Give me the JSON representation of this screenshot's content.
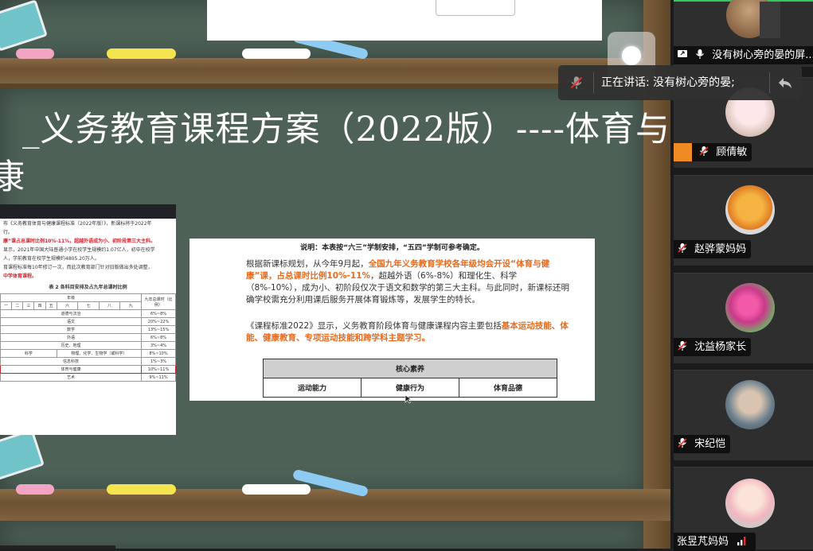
{
  "slide": {
    "title_line1": "_义务教育课程方案（2022版）----体育与",
    "title_line2": "康",
    "doc_image": {
      "line1": "布《义务教育体育与健康课程标准（2022年版）》，新课标将于2022年",
      "line2": "行。",
      "line3_red": "康”课占总课时比例10%-11%，超越外语成为小、初阶段第三大主科。",
      "line4": "显示，2021年中国大陆普通小学在校学生规模约1.07亿人，初中在校学",
      "line5": "人，学前教育在校学生规模约4805.20万人。",
      "line6": "育课程标准每10年修订一次，而此次教育部门针对旧版做出多处调整，",
      "line7_red": "中学体育课程。",
      "table_title": "表 2   各科目安排及占九年总课时比例",
      "col_header": "年级",
      "col_ratio": "九年总课时（比例）",
      "grades": [
        "一",
        "二",
        "三",
        "四",
        "五",
        "六",
        "七",
        "八",
        "九"
      ],
      "rows": [
        {
          "subject": "道德与法治",
          "ratio": "6%~8%"
        },
        {
          "subject": "语文",
          "ratio": "20%~22%"
        },
        {
          "subject": "数学",
          "ratio": "13%~15%"
        },
        {
          "subject": "外语",
          "ratio": "6%~8%"
        },
        {
          "subject": "历史、地理",
          "ratio": "3%~4%"
        },
        {
          "subject": "科学",
          "sub2": "物理、化学、生物学（或科学）",
          "ratio": "8%~10%"
        },
        {
          "subject": "信息科技",
          "ratio": "1%~3%"
        },
        {
          "subject": "体育与健康",
          "ratio": "10%~11%"
        },
        {
          "subject": "艺术",
          "ratio": "9%~11%"
        }
      ]
    },
    "info_panel": {
      "note": "说明：本表按“六三”学制安排，“五四”学制可参考确定。",
      "p1_a": "根据新课标规划，从今年9月起，",
      "p1_hl1": "全国九年义务教育学校各年级均会开设“体育与健康”课，占总课时比例10%-11%",
      "p1_b": "，超越外语（6%-8%）和理化生、科学（8%-10%），成为小、初阶段仅次于语文和数学的第三大主科。与此同时，新课标还明确学校需充分利用课后服务开展体育锻炼等，发展学生的特长。",
      "p2_a": "《课程标准2022》显示，义务教育阶段体育与健康课程内容主要包括",
      "p2_hl": "基本运动技能、体能、健康教育、专项运动技能和跨学科主题学习。",
      "table_head": "核心素养",
      "table_cells": [
        "运动能力",
        "健康行为",
        "体育品德"
      ]
    }
  },
  "speaking_tooltip": {
    "text": "正在讲话: 没有树心旁的晏;"
  },
  "participants": [
    {
      "name": "没有树心旁的晏的屏...",
      "mic": "on",
      "screen_share": true
    },
    {
      "name": "顾倩敏",
      "mic": "muted",
      "host_badge": true
    },
    {
      "name": "赵骅蒙妈妈",
      "mic": "muted"
    },
    {
      "name": "沈益杨家长",
      "mic": "muted"
    },
    {
      "name": "宋纪恺",
      "mic": "muted"
    },
    {
      "name": "张昱芃妈妈",
      "mic": "signal"
    }
  ],
  "colors": {
    "board": "#4d6157",
    "highlight_orange": "#e96a1c",
    "speaker_border": "#34c759",
    "muted_red": "#e0322f"
  }
}
